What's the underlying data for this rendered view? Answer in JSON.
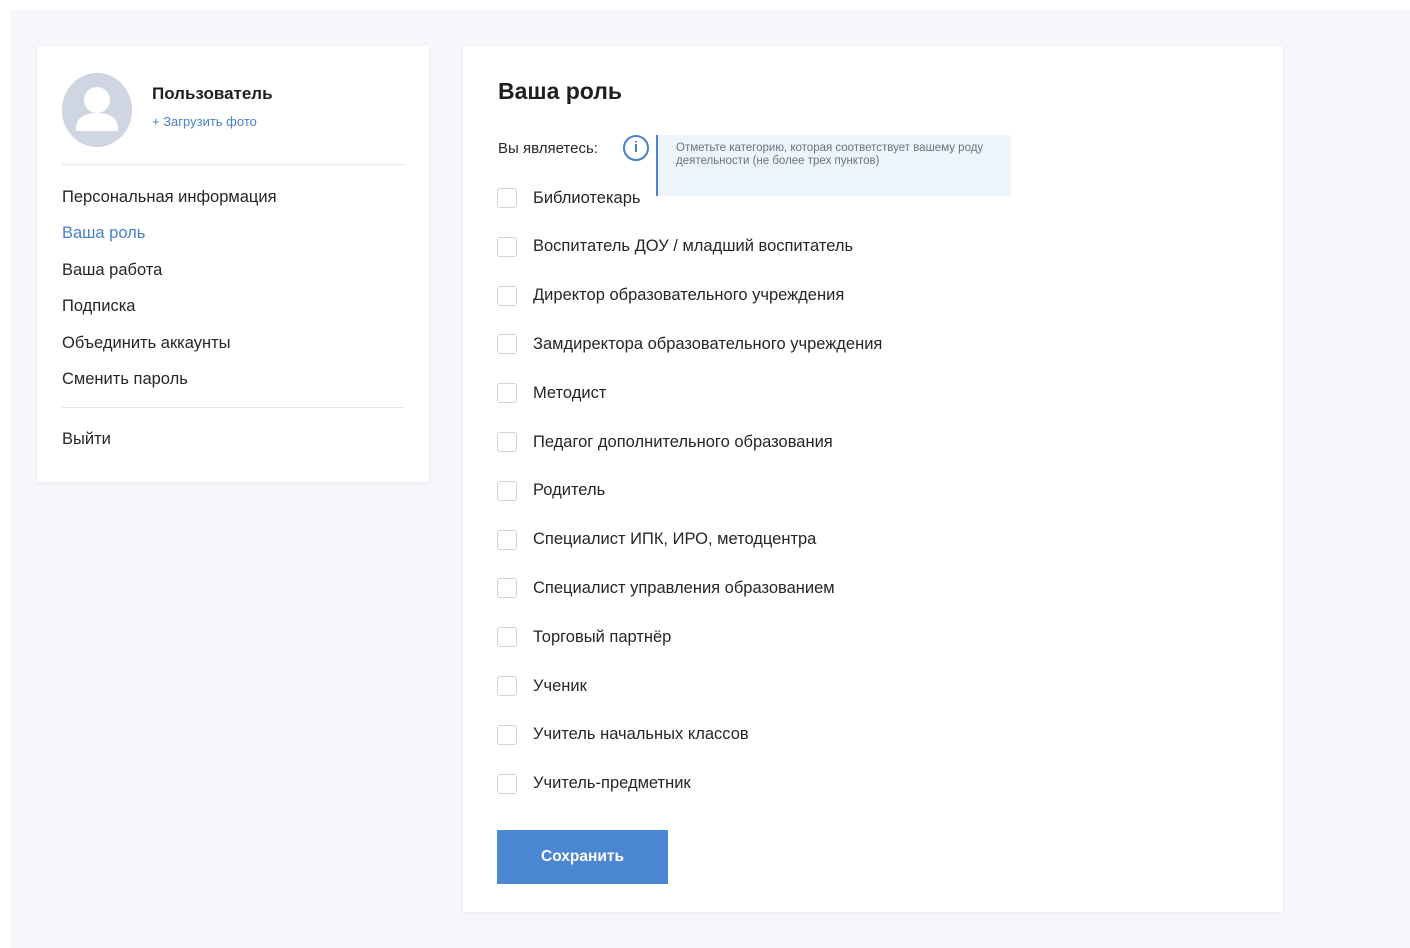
{
  "user": {
    "name": "Пользователь",
    "upload_photo": "+ Загрузить фото"
  },
  "sidebar": {
    "items": [
      {
        "label": "Персональная информация",
        "active": false
      },
      {
        "label": "Ваша роль",
        "active": true
      },
      {
        "label": "Ваша работа",
        "active": false
      },
      {
        "label": "Подписка",
        "active": false
      },
      {
        "label": "Объединить аккаунты",
        "active": false
      },
      {
        "label": "Сменить пароль",
        "active": false
      }
    ],
    "logout": "Выйти"
  },
  "main": {
    "title": "Ваша роль",
    "you_are_label": "Вы являетесь:",
    "info_icon_glyph": "i",
    "tooltip": "Отметьте категорию, которая соответствует вашему роду деятельности (не более трех пунктов)",
    "options": [
      {
        "label": "Библиотекарь",
        "checked": false
      },
      {
        "label": "Воспитатель ДОУ / младший воспитатель",
        "checked": false
      },
      {
        "label": "Директор образовательного учреждения",
        "checked": false
      },
      {
        "label": "Замдиректора образовательного учреждения",
        "checked": false
      },
      {
        "label": "Методист",
        "checked": false
      },
      {
        "label": "Педагог дополнительного образования",
        "checked": false
      },
      {
        "label": "Родитель",
        "checked": false
      },
      {
        "label": "Специалист ИПК, ИРО, методцентра",
        "checked": false
      },
      {
        "label": "Специалист управления образованием",
        "checked": false
      },
      {
        "label": "Торговый партнёр",
        "checked": false
      },
      {
        "label": "Ученик",
        "checked": false
      },
      {
        "label": "Учитель начальных классов",
        "checked": false
      },
      {
        "label": "Учитель-предметник",
        "checked": false
      }
    ],
    "save_label": "Сохранить"
  },
  "colors": {
    "accent": "#4a7fc9",
    "button": "#4a86d1",
    "background": "#f6f7fa",
    "avatar": "#cfd5e1",
    "tooltip_bg": "#eef4fc"
  },
  "icons": {
    "avatar": "user-silhouette-icon",
    "info": "info-icon"
  }
}
